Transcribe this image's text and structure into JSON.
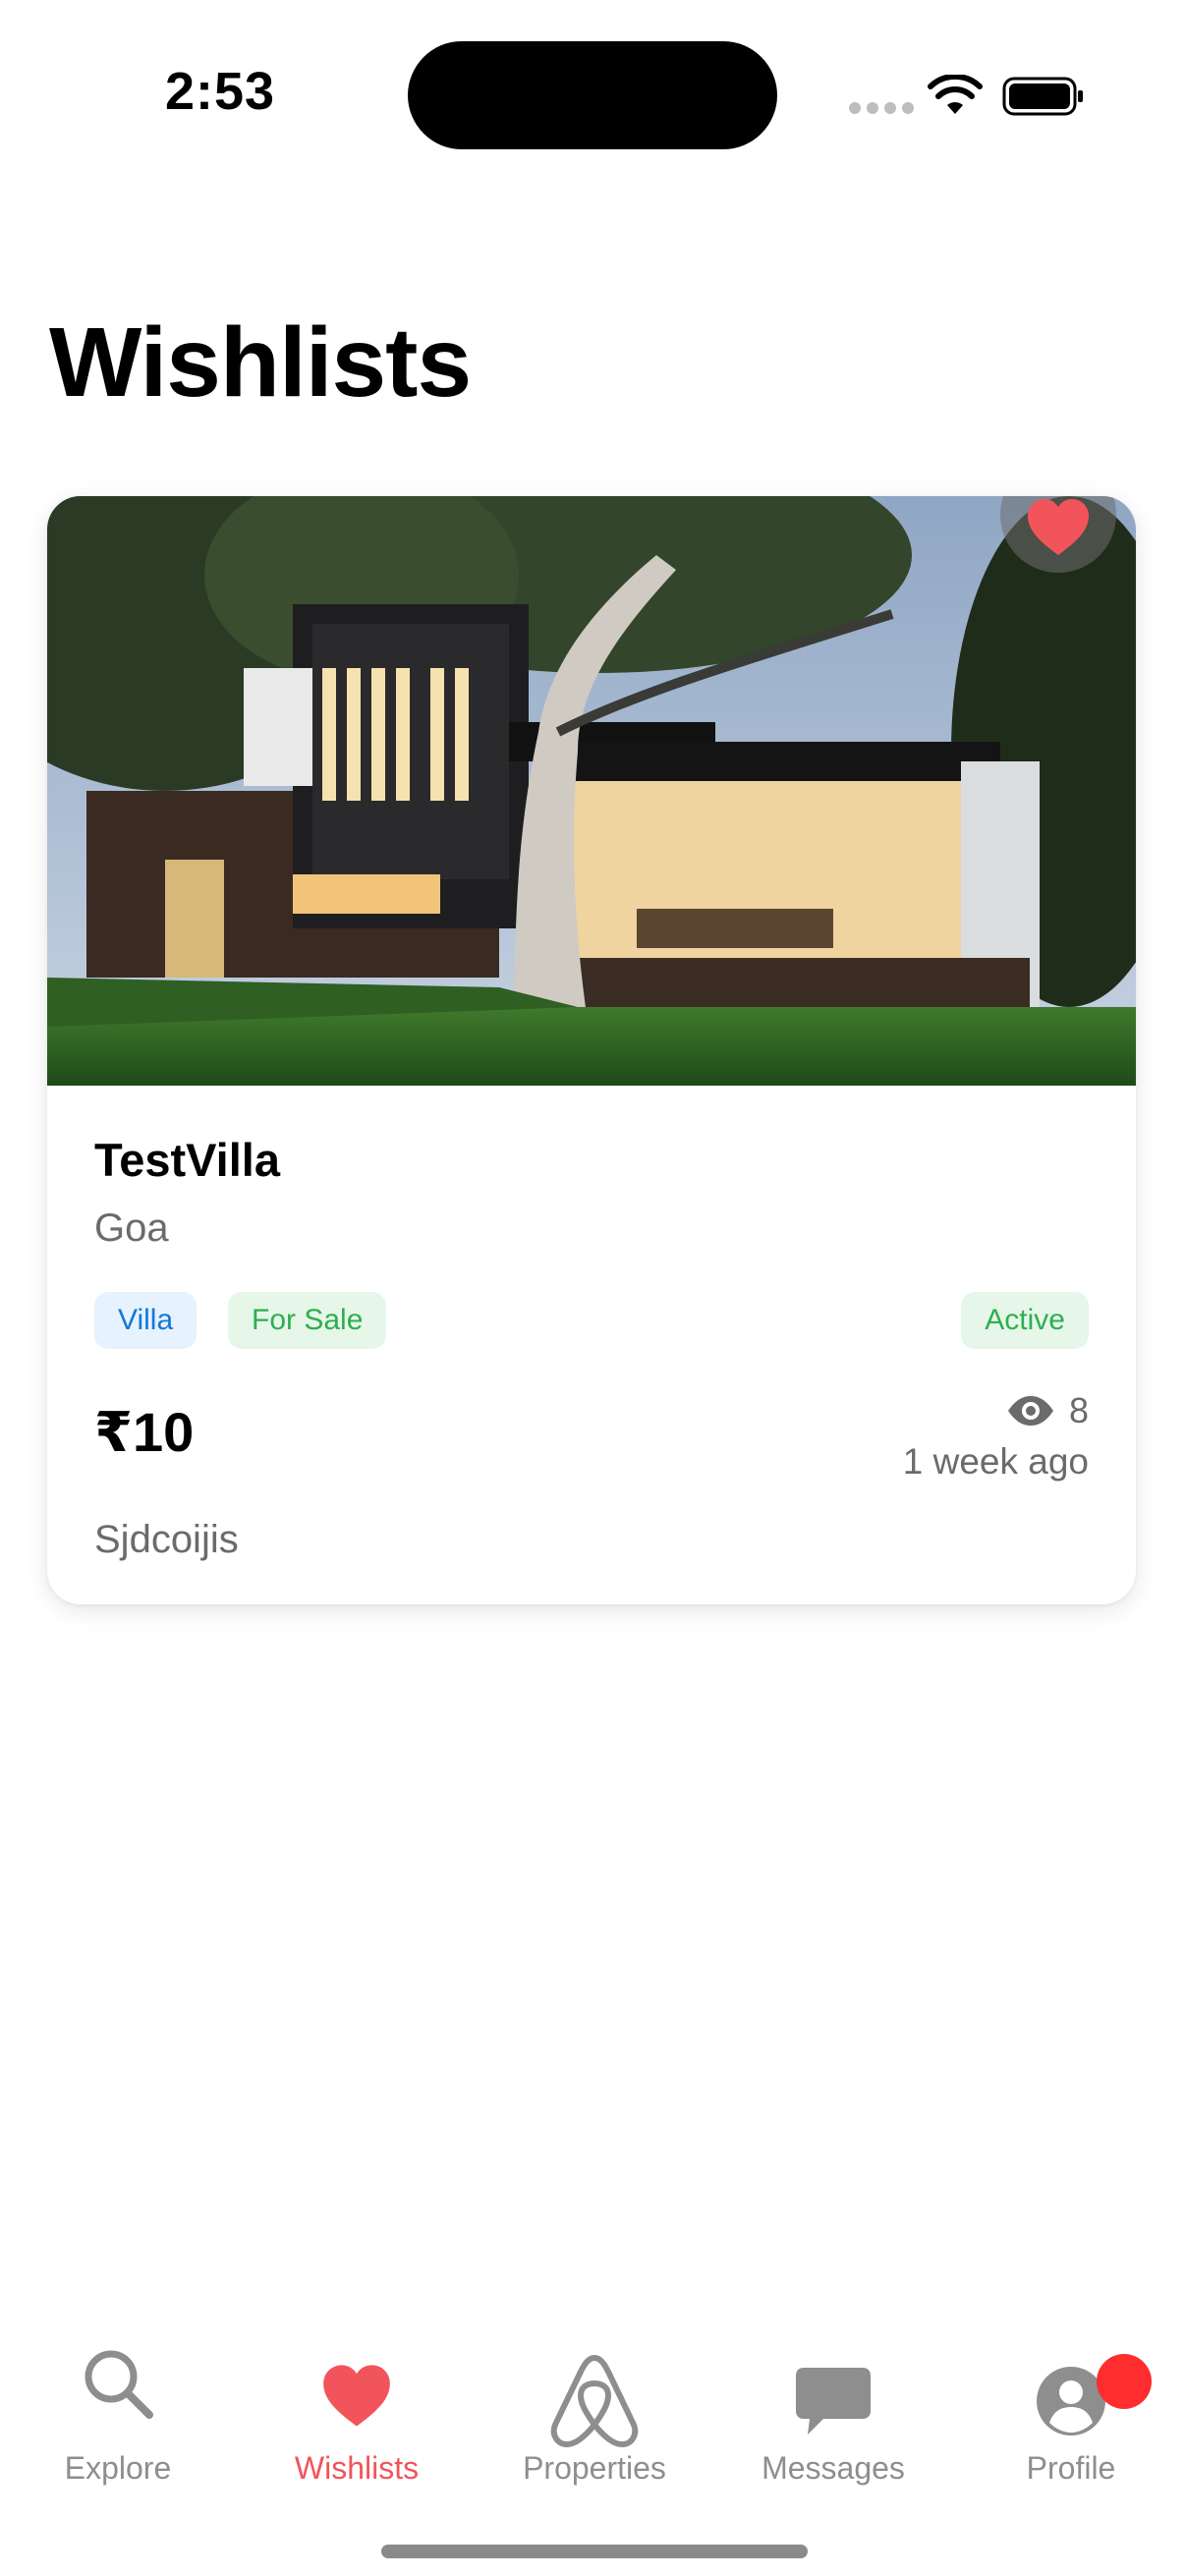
{
  "status_bar": {
    "time": "2:53"
  },
  "page": {
    "title": "Wishlists"
  },
  "listing": {
    "name": "TestVilla",
    "location": "Goa",
    "tags": {
      "type": "Villa",
      "purpose": "For Sale",
      "status": "Active"
    },
    "price": "₹10",
    "views": "8",
    "posted": "1 week ago",
    "description": "Sjdcoijis",
    "wishlisted": true,
    "image_icon": "house-photo"
  },
  "tab_bar": {
    "tabs": [
      {
        "label": "Explore",
        "icon": "search-icon",
        "active": false
      },
      {
        "label": "Wishlists",
        "icon": "heart-icon",
        "active": true
      },
      {
        "label": "Properties",
        "icon": "airbnb-logo-icon",
        "active": false
      },
      {
        "label": "Messages",
        "icon": "chat-bubble-icon",
        "active": false
      },
      {
        "label": "Profile",
        "icon": "person-icon",
        "active": false
      }
    ]
  },
  "colors": {
    "accent": "#f2545b",
    "tab_inactive": "#8e8e8e",
    "villa_tag": "#1479d6",
    "sale_tag": "#2fae4f",
    "badge": "#ff2d2d"
  }
}
